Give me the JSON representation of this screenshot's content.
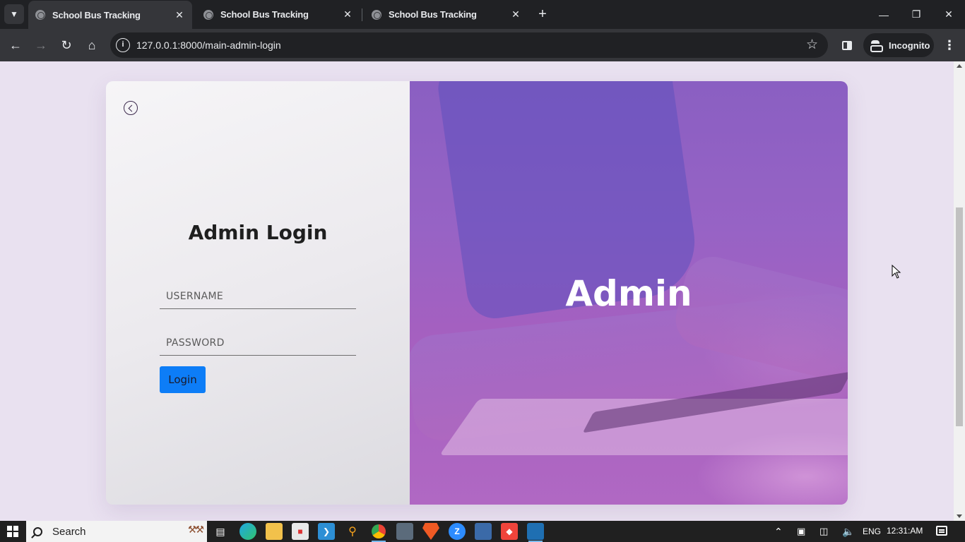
{
  "browser": {
    "tabs": [
      {
        "title": "School Bus Tracking",
        "active": true
      },
      {
        "title": "School Bus Tracking",
        "active": false
      },
      {
        "title": "School Bus Tracking",
        "active": false
      }
    ],
    "url": "127.0.0.1:8000/main-admin-login",
    "incognito_label": "Incognito"
  },
  "page": {
    "login_title": "Admin Login",
    "username_placeholder": "USERNAME",
    "password_placeholder": "PASSWORD",
    "login_button": "Login",
    "hero_title": "Admin"
  },
  "taskbar": {
    "search_label": "Search",
    "language": "ENG",
    "time": "12:31:AM",
    "apps": [
      "task-view",
      "edge",
      "file-explorer",
      "app-red",
      "vscode",
      "search-app",
      "chrome",
      "remote-desktop",
      "brave",
      "zoom",
      "virtualbox",
      "anydesk",
      "app-blue"
    ]
  },
  "colors": {
    "accent": "#0d7df7",
    "hero_overlay": "#9763c5",
    "page_bg": "#e9e1f0"
  }
}
